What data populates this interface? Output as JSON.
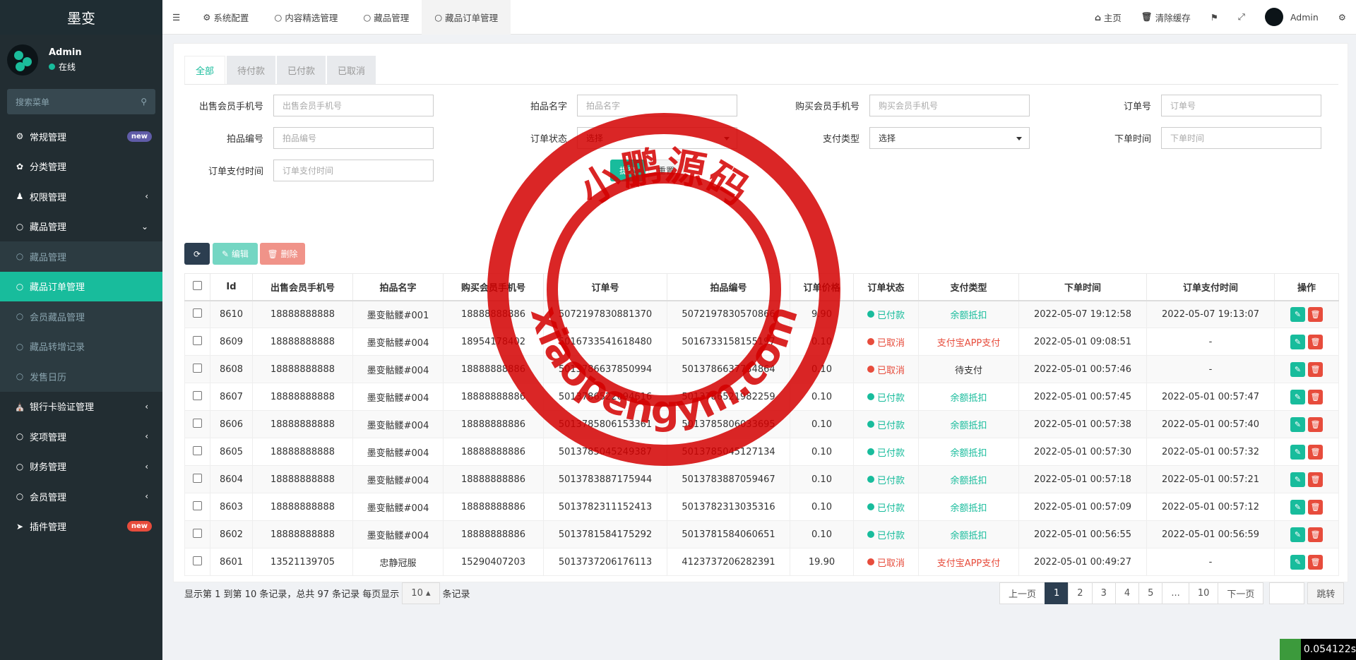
{
  "app": {
    "title": "墨变"
  },
  "user": {
    "name": "Admin",
    "status": "在线"
  },
  "sidebar": {
    "search_placeholder": "搜索菜单",
    "items": [
      {
        "label": "常规管理",
        "badge": "new"
      },
      {
        "label": "分类管理"
      },
      {
        "label": "权限管理"
      },
      {
        "label": "藏品管理"
      },
      {
        "label": "藏品管理"
      },
      {
        "label": "藏品订单管理"
      },
      {
        "label": "会员藏品管理"
      },
      {
        "label": "藏品转增记录"
      },
      {
        "label": "发售日历"
      },
      {
        "label": "银行卡验证管理"
      },
      {
        "label": "奖项管理"
      },
      {
        "label": "财务管理"
      },
      {
        "label": "会员管理"
      },
      {
        "label": "插件管理",
        "badge": "new"
      }
    ]
  },
  "topbar": {
    "tabs": [
      "系统配置",
      "内容精选管理",
      "藏品管理",
      "藏品订单管理"
    ],
    "home": "主页",
    "clear_cache": "清除缓存",
    "user": "Admin"
  },
  "status_tabs": [
    "全部",
    "待付款",
    "已付款",
    "已取消"
  ],
  "form": {
    "seller_phone": {
      "label": "出售会员手机号",
      "placeholder": "出售会员手机号"
    },
    "item_name": {
      "label": "拍品名字",
      "placeholder": "拍品名字"
    },
    "buyer_phone": {
      "label": "购买会员手机号",
      "placeholder": "购买会员手机号"
    },
    "order_no": {
      "label": "订单号",
      "placeholder": "订单号"
    },
    "item_no": {
      "label": "拍品编号",
      "placeholder": "拍品编号"
    },
    "order_status": {
      "label": "订单状态",
      "value": "选择"
    },
    "pay_type": {
      "label": "支付类型",
      "value": "选择"
    },
    "order_time": {
      "label": "下单时间",
      "placeholder": "下单时间"
    },
    "pay_time": {
      "label": "订单支付时间",
      "placeholder": "订单支付时间"
    },
    "submit": "提交",
    "reset": "重置"
  },
  "toolbar": {
    "edit": "编辑",
    "delete": "删除"
  },
  "table": {
    "headers": [
      "Id",
      "出售会员手机号",
      "拍品名字",
      "购买会员手机号",
      "订单号",
      "拍品编号",
      "订单价格",
      "订单状态",
      "支付类型",
      "下单时间",
      "订单支付时间",
      "操作"
    ],
    "rows": [
      [
        "8610",
        "18888888888",
        "墨变骷髅#001",
        "18888888886",
        "5072197830881370",
        "5072197830570866",
        "9.90",
        "已付款",
        "余额抵扣",
        "2022-05-07 19:12:58",
        "2022-05-07 19:13:07"
      ],
      [
        "8609",
        "18888888888",
        "墨变骷髅#004",
        "18954178402",
        "5016733541618480",
        "5016733158155197",
        "0.10",
        "已取消",
        "支付宝APP支付",
        "2022-05-01 09:08:51",
        "-"
      ],
      [
        "8608",
        "18888888888",
        "墨变骷髅#004",
        "18888888886",
        "5013786637850994",
        "5013786637734864",
        "0.10",
        "已取消",
        "待支付",
        "2022-05-01 00:57:46",
        "-"
      ],
      [
        "8607",
        "18888888888",
        "墨变骷髅#004",
        "18888888886",
        "5013786522094616",
        "5013786521982259",
        "0.10",
        "已付款",
        "余额抵扣",
        "2022-05-01 00:57:45",
        "2022-05-01 00:57:47"
      ],
      [
        "8606",
        "18888888888",
        "墨变骷髅#004",
        "18888888886",
        "5013785806153361",
        "5013785806033695",
        "0.10",
        "已付款",
        "余额抵扣",
        "2022-05-01 00:57:38",
        "2022-05-01 00:57:40"
      ],
      [
        "8605",
        "18888888888",
        "墨变骷髅#004",
        "18888888886",
        "5013785045249387",
        "5013785045127134",
        "0.10",
        "已付款",
        "余额抵扣",
        "2022-05-01 00:57:30",
        "2022-05-01 00:57:32"
      ],
      [
        "8604",
        "18888888888",
        "墨变骷髅#004",
        "18888888886",
        "5013783887175944",
        "5013783887059467",
        "0.10",
        "已付款",
        "余额抵扣",
        "2022-05-01 00:57:18",
        "2022-05-01 00:57:21"
      ],
      [
        "8603",
        "18888888888",
        "墨变骷髅#004",
        "18888888886",
        "5013782311152413",
        "5013782313035316",
        "0.10",
        "已付款",
        "余额抵扣",
        "2022-05-01 00:57:09",
        "2022-05-01 00:57:12"
      ],
      [
        "8602",
        "18888888888",
        "墨变骷髅#004",
        "18888888886",
        "5013781584175292",
        "5013781584060651",
        "0.10",
        "已付款",
        "余额抵扣",
        "2022-05-01 00:56:55",
        "2022-05-01 00:56:59"
      ],
      [
        "8601",
        "13521139705",
        "忠静冠服",
        "15290407203",
        "5013737206176113",
        "4123737206282391",
        "19.90",
        "已取消",
        "支付宝APP支付",
        "2022-05-01 00:49:27",
        "-"
      ]
    ]
  },
  "pagination": {
    "summary": "显示第 1 到第 10 条记录，总共 97 条记录 每页显示",
    "page_size": "10",
    "suffix": "条记录",
    "prev": "上一页",
    "pages": [
      "1",
      "2",
      "3",
      "4",
      "5",
      "...",
      "10"
    ],
    "next": "下一页",
    "jump": "跳转"
  },
  "watermark": {
    "cn": "小鹏源码",
    "url": "xiaopengym.com"
  },
  "timer": "0.054122s",
  "colors": {
    "accent": "#18bc9c",
    "danger": "#e74c3c",
    "sidebar": "#222d32",
    "paid": "#18bc9c",
    "cancel": "#e74c3c"
  }
}
